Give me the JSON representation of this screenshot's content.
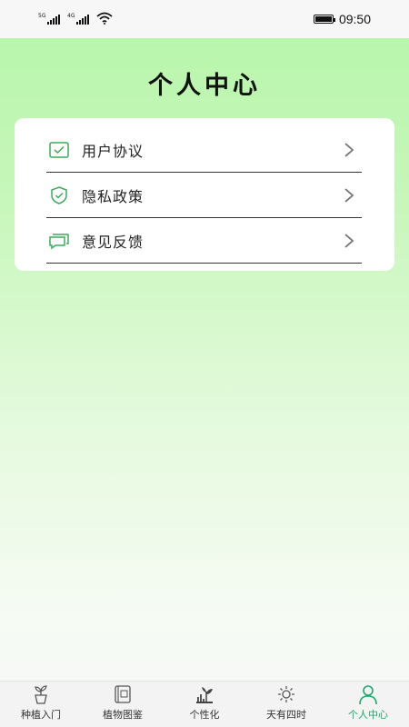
{
  "status_bar": {
    "sim1_tag": "5G",
    "sim2_tag": "4G",
    "time": "09:50"
  },
  "header": {
    "title": "个人中心"
  },
  "menu": {
    "items": [
      {
        "label": "用户协议",
        "icon": "checkbox-icon"
      },
      {
        "label": "隐私政策",
        "icon": "shield-check-icon"
      },
      {
        "label": "意见反馈",
        "icon": "chat-bubbles-icon"
      }
    ]
  },
  "tab_bar": {
    "active_color": "#19a96a",
    "items": [
      {
        "label": "种植入门",
        "icon": "plant-pot-icon"
      },
      {
        "label": "植物图鉴",
        "icon": "book-icon"
      },
      {
        "label": "个性化",
        "icon": "plant-icon"
      },
      {
        "label": "天有四时",
        "icon": "sun-snow-icon"
      },
      {
        "label": "个人中心",
        "icon": "person-icon",
        "active": true
      }
    ]
  },
  "colors": {
    "accent": "#19a96a",
    "icon_green": "#3aab5a"
  }
}
